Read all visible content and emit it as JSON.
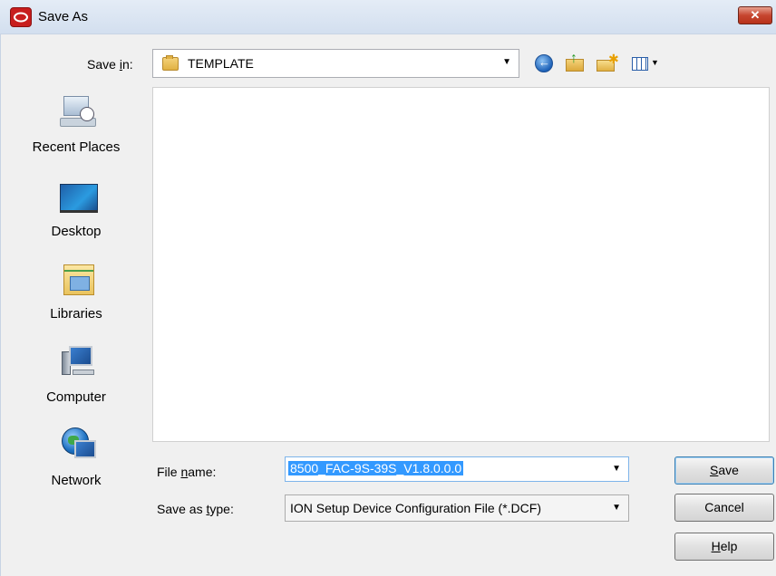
{
  "window": {
    "title": "Save As",
    "close_label": "✕"
  },
  "save_in": {
    "label": "Save ",
    "label_u": "i",
    "label_rest": "n:",
    "value": "TEMPLATE"
  },
  "places": [
    {
      "label": "Recent Places",
      "icon": "recent-places-icon"
    },
    {
      "label": "Desktop",
      "icon": "desktop-icon"
    },
    {
      "label": "Libraries",
      "icon": "libraries-icon"
    },
    {
      "label": "Computer",
      "icon": "computer-icon"
    },
    {
      "label": "Network",
      "icon": "network-icon"
    }
  ],
  "file_name": {
    "label_pre": "File ",
    "label_u": "n",
    "label_post": "ame:",
    "value": "8500_FAC-9S-39S_V1.8.0.0.0"
  },
  "save_as_type": {
    "label_pre": "Save as ",
    "label_u": "t",
    "label_post": "ype:",
    "value": "ION Setup Device Configuration File (*.DCF)"
  },
  "buttons": {
    "save_u": "S",
    "save_rest": "ave",
    "cancel": "Cancel",
    "help_u": "H",
    "help_rest": "elp"
  },
  "colors": {
    "selection": "#3399ff",
    "close": "#c6452f"
  }
}
